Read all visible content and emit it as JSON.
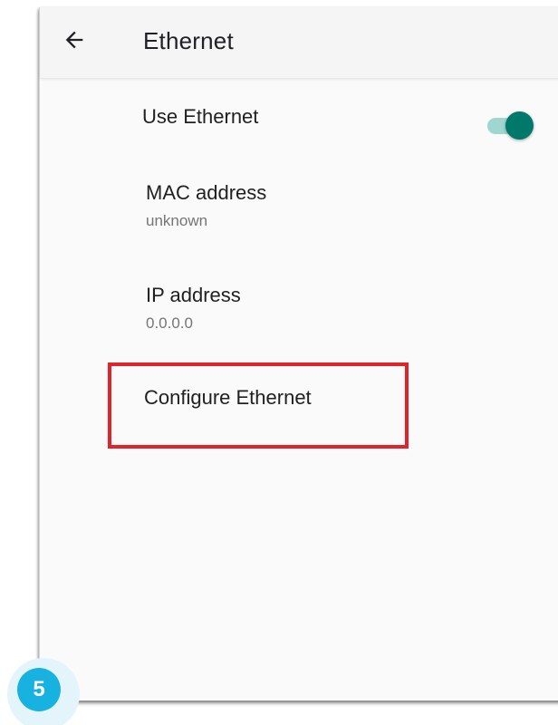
{
  "appbar": {
    "title": "Ethernet",
    "back_icon": "arrow-back-icon"
  },
  "settings": {
    "use_ethernet": {
      "label": "Use Ethernet",
      "enabled": true
    },
    "mac_address": {
      "label": "MAC address",
      "value": "unknown"
    },
    "ip_address": {
      "label": "IP address",
      "value": "0.0.0.0"
    },
    "configure": {
      "label": "Configure Ethernet"
    }
  },
  "annotation": {
    "step_number": "5",
    "highlight_color": "#e0242b",
    "badge_color": "#18b2e0"
  },
  "colors": {
    "accent": "#00796b",
    "track": "#9fd6cf",
    "background": "#fafafa"
  }
}
